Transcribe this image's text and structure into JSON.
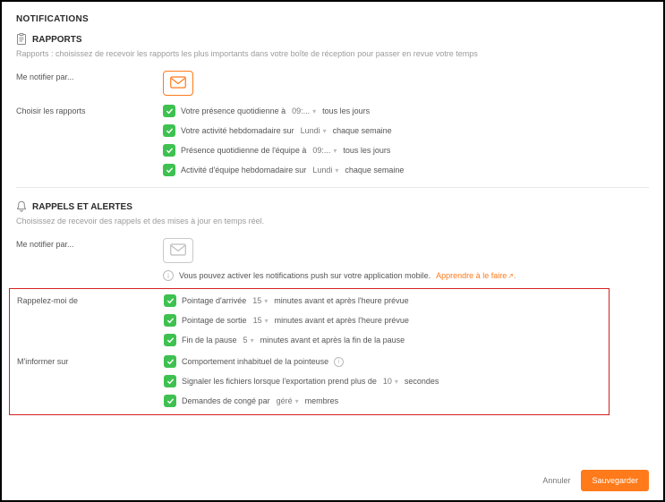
{
  "page_title": "NOTIFICATIONS",
  "reports": {
    "title": "RAPPORTS",
    "desc": "Rapports : choisissez de recevoir les rapports les plus importants dans votre boîte de réception pour passer en revue votre temps",
    "notify_label": "Me notifier par...",
    "choose_label": "Choisir les rapports",
    "items": [
      {
        "pre": "Votre présence quotidienne à",
        "sel": "09:...",
        "post": "tous les jours"
      },
      {
        "pre": "Votre activité hebdomadaire sur",
        "sel": "Lundi",
        "post": "chaque semaine"
      },
      {
        "pre": "Présence quotidienne de l'équipe à",
        "sel": "09:...",
        "post": "tous les jours"
      },
      {
        "pre": "Activité d'équipe hebdomadaire sur",
        "sel": "Lundi",
        "post": "chaque semaine"
      }
    ]
  },
  "alerts": {
    "title": "RAPPELS ET ALERTES",
    "desc": "Choisissez de recevoir des rappels et des mises à jour en temps réel.",
    "notify_label": "Me notifier par...",
    "push_note": "Vous pouvez activer les notifications push sur votre application mobile.",
    "push_link": "Apprendre à le faire",
    "remind_label": "Rappelez-moi de",
    "remind_items": [
      {
        "pre": "Pointage d'arrivée",
        "sel": "15",
        "post": "minutes avant et après l'heure prévue"
      },
      {
        "pre": "Pointage de sortie",
        "sel": "15",
        "post": "minutes avant et après l'heure prévue"
      },
      {
        "pre": "Fin de la pause",
        "sel": "5",
        "post": "minutes avant et après la fin de la pause"
      }
    ],
    "inform_label": "M'informer sur",
    "inform_items": [
      {
        "text": "Comportement inhabituel de la pointeuse",
        "info": true
      },
      {
        "pre": "Signaler les fichiers lorsque l'exportation prend plus de",
        "sel": "10",
        "post": "secondes"
      },
      {
        "pre": "Demandes de congé par",
        "sel": "géré",
        "post": "membres"
      }
    ]
  },
  "footer": {
    "cancel": "Annuler",
    "save": "Sauvegarder"
  }
}
